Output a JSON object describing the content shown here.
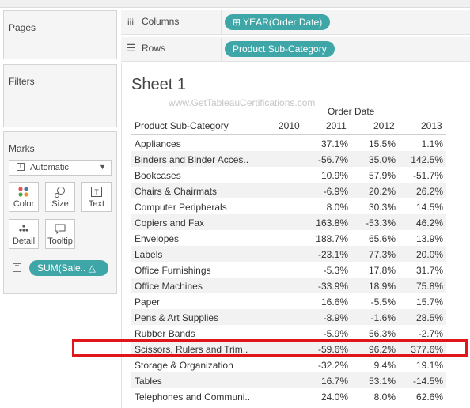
{
  "left_panel": {
    "pages_title": "Pages",
    "filters_title": "Filters",
    "marks_title": "Marks",
    "mark_type": "Automatic",
    "mark_buttons": [
      "Color",
      "Size",
      "Text",
      "Detail",
      "Tooltip"
    ],
    "marks_pill": "SUM(Sale.. △"
  },
  "shelves": {
    "columns_label": "Columns",
    "columns_pill": "⊞ YEAR(Order Date)",
    "rows_label": "Rows",
    "rows_pill": "Product Sub-Category"
  },
  "sheet": {
    "title": "Sheet 1",
    "watermark": "www.GetTableauCertifications.com",
    "column_group_header": "Order Date",
    "row_header": "Product Sub-Category",
    "years": [
      "2010",
      "2011",
      "2012",
      "2013"
    ],
    "rows": [
      {
        "name": "Appliances",
        "v2011": "37.1%",
        "v2012": "15.5%",
        "v2013": "1.1%"
      },
      {
        "name": "Binders and Binder Acces..",
        "v2011": "-56.7%",
        "v2012": "35.0%",
        "v2013": "142.5%"
      },
      {
        "name": "Bookcases",
        "v2011": "10.9%",
        "v2012": "57.9%",
        "v2013": "-51.7%"
      },
      {
        "name": "Chairs & Chairmats",
        "v2011": "-6.9%",
        "v2012": "20.2%",
        "v2013": "26.2%"
      },
      {
        "name": "Computer Peripherals",
        "v2011": "8.0%",
        "v2012": "30.3%",
        "v2013": "14.5%"
      },
      {
        "name": "Copiers and Fax",
        "v2011": "163.8%",
        "v2012": "-53.3%",
        "v2013": "46.2%"
      },
      {
        "name": "Envelopes",
        "v2011": "188.7%",
        "v2012": "65.6%",
        "v2013": "13.9%"
      },
      {
        "name": "Labels",
        "v2011": "-23.1%",
        "v2012": "77.3%",
        "v2013": "20.0%"
      },
      {
        "name": "Office Furnishings",
        "v2011": "-5.3%",
        "v2012": "17.8%",
        "v2013": "31.7%"
      },
      {
        "name": "Office Machines",
        "v2011": "-33.9%",
        "v2012": "18.9%",
        "v2013": "75.8%"
      },
      {
        "name": "Paper",
        "v2011": "16.6%",
        "v2012": "-5.5%",
        "v2013": "15.7%"
      },
      {
        "name": "Pens & Art Supplies",
        "v2011": "-8.9%",
        "v2012": "-1.6%",
        "v2013": "28.5%"
      },
      {
        "name": "Rubber Bands",
        "v2011": "-5.9%",
        "v2012": "56.3%",
        "v2013": "-2.7%"
      },
      {
        "name": "Scissors, Rulers and Trim..",
        "v2011": "-59.6%",
        "v2012": "96.2%",
        "v2013": "377.6%"
      },
      {
        "name": "Storage & Organization",
        "v2011": "-32.2%",
        "v2012": "9.4%",
        "v2013": "19.1%"
      },
      {
        "name": "Tables",
        "v2011": "16.7%",
        "v2012": "53.1%",
        "v2013": "-14.5%"
      },
      {
        "name": "Telephones and Communi..",
        "v2011": "24.0%",
        "v2012": "8.0%",
        "v2013": "62.6%"
      }
    ]
  },
  "colors": {
    "pill": "#3fa6a8",
    "highlight": "#e0161b",
    "alt_row": "#f2f2f2"
  }
}
